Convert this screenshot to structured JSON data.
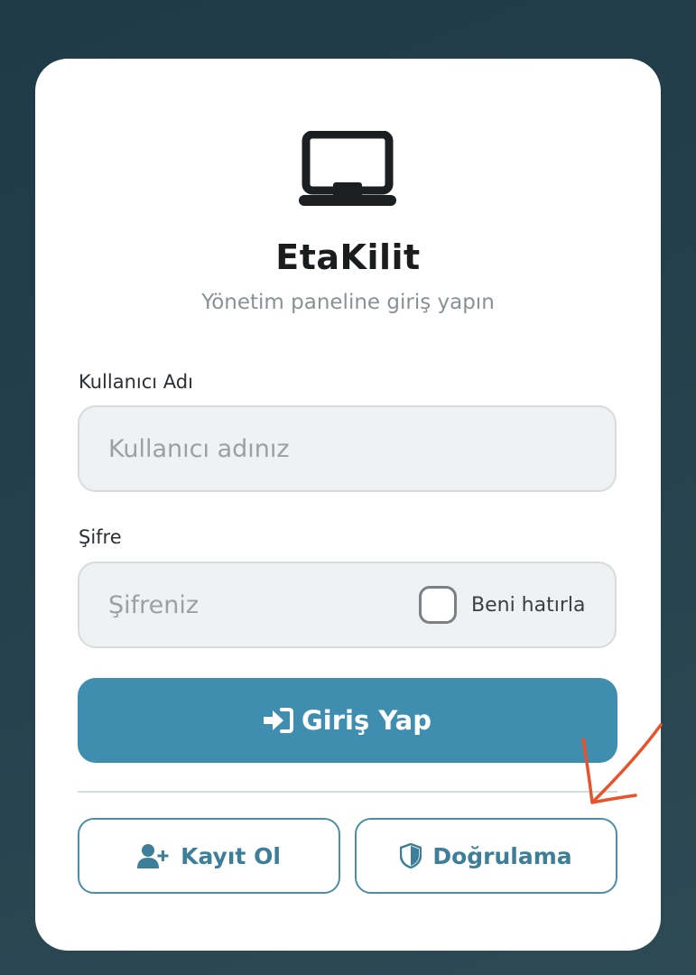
{
  "app": {
    "title": "EtaKilit",
    "subtitle": "Yönetim paneline giriş yapın"
  },
  "form": {
    "username": {
      "label": "Kullanıcı Adı",
      "placeholder": "Kullanıcı adınız",
      "value": ""
    },
    "password": {
      "label": "Şifre",
      "placeholder": "Şifreniz",
      "value": ""
    },
    "remember": {
      "label": "Beni hatırla",
      "checked": false
    },
    "submit_label": "Giriş Yap"
  },
  "secondary_actions": {
    "register_label": "Kayıt Ol",
    "verify_label": "Doğrulama"
  },
  "icons": {
    "logo": "laptop-icon",
    "submit": "sign-in-icon",
    "register": "user-plus-icon",
    "verify": "shield-icon"
  },
  "colors": {
    "background": "#25404c",
    "card": "#ffffff",
    "accent": "#3f8eb0",
    "outline_text": "#3d7f98",
    "annotation": "#e8532b"
  }
}
